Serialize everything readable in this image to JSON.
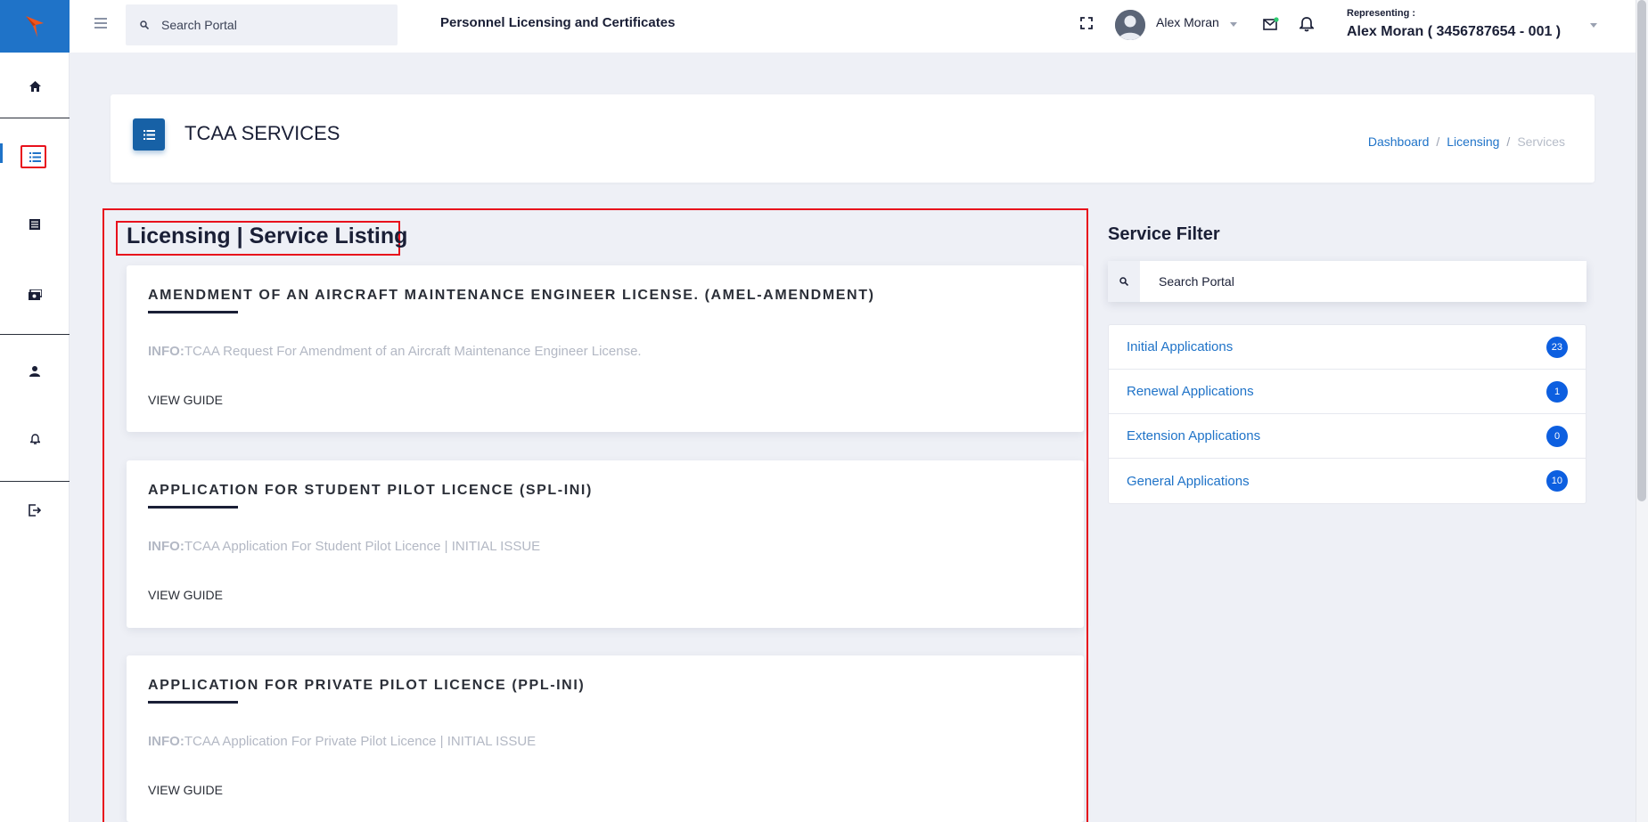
{
  "header": {
    "search_placeholder": "Search Portal",
    "portal_title": "Personnel Licensing and Certificates",
    "user_name": "Alex Moran",
    "representing_label": "Representing :",
    "representing_value": "Alex Moran ( 3456787654 - 001 )"
  },
  "sidebar": {
    "icons": [
      "home-icon",
      "list-icon",
      "document-icon",
      "payment-icon",
      "user-icon",
      "bell-icon",
      "logout-icon"
    ],
    "active": "list-icon"
  },
  "page": {
    "title": "TCAA SERVICES",
    "breadcrumb": [
      "Dashboard",
      "Licensing",
      "Services"
    ]
  },
  "listing": {
    "heading": "Licensing | Service Listing",
    "services": [
      {
        "title": "AMENDMENT OF AN AIRCRAFT MAINTENANCE ENGINEER LICENSE. (AMEL-AMENDMENT)",
        "info_label": "INFO:",
        "info_text": "TCAA Request For Amendment of an Aircraft Maintenance Engineer License.",
        "guide_label": "VIEW GUIDE"
      },
      {
        "title": "APPLICATION FOR STUDENT PILOT LICENCE (SPL-INI)",
        "info_label": "INFO:",
        "info_text": "TCAA Application For Student Pilot Licence | INITIAL ISSUE",
        "guide_label": "VIEW GUIDE"
      },
      {
        "title": "APPLICATION FOR PRIVATE PILOT LICENCE (PPL-INI)",
        "info_label": "INFO:",
        "info_text": "TCAA Application For Private Pilot Licence | INITIAL ISSUE",
        "guide_label": "VIEW GUIDE"
      }
    ]
  },
  "filter": {
    "title": "Service Filter",
    "search_placeholder": "Search Portal",
    "items": [
      {
        "label": "Initial Applications",
        "count": "23"
      },
      {
        "label": "Renewal Applications",
        "count": "1"
      },
      {
        "label": "Extension Applications",
        "count": "0"
      },
      {
        "label": "General Applications",
        "count": "10"
      }
    ]
  },
  "colors": {
    "brand_blue": "#1f73c8",
    "logo_orange": "#f0551e",
    "highlight_red": "#e8101c",
    "badge_blue": "#0d5fe0"
  }
}
